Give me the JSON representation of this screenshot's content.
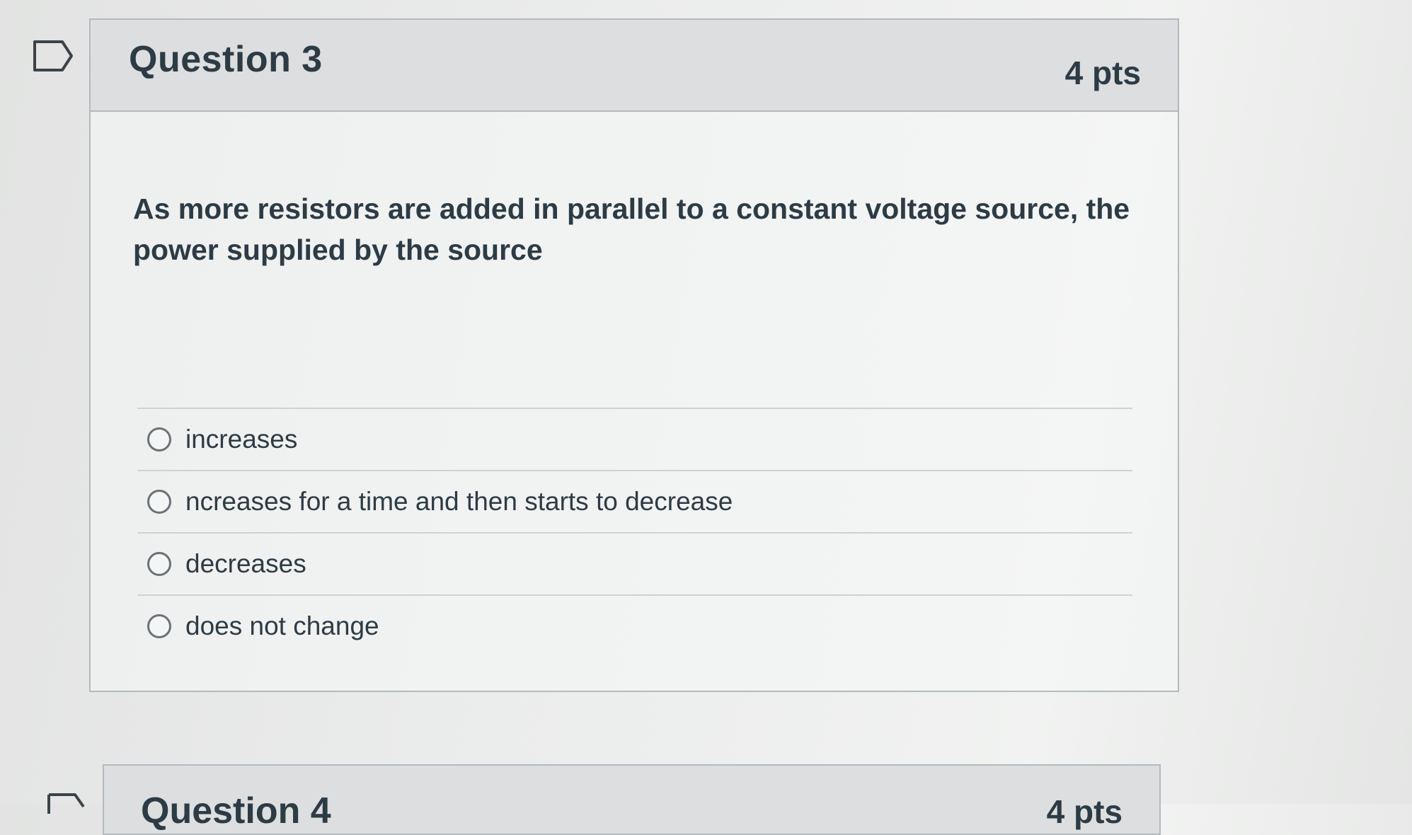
{
  "question": {
    "title": "Question 3",
    "points": "4 pts",
    "text": "As more resistors are added in parallel to a constant voltage source, the power supplied by the source",
    "answers": [
      {
        "label": "increases"
      },
      {
        "label": "ncreases for a time and then starts to decrease"
      },
      {
        "label": "decreases"
      },
      {
        "label": "does not change"
      }
    ]
  },
  "next_question": {
    "title": "Question 4",
    "points": "4 pts"
  }
}
